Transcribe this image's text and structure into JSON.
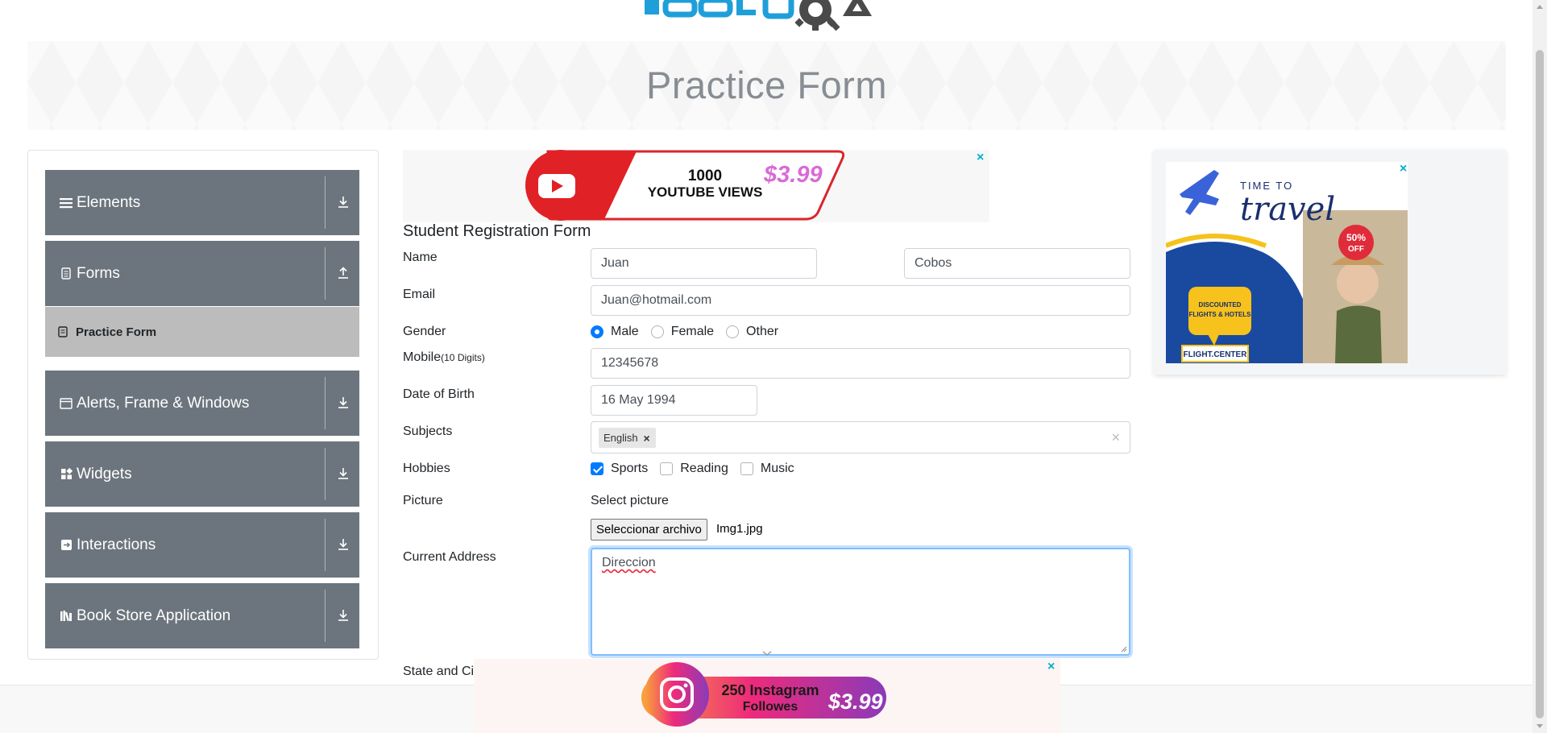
{
  "header": {
    "logo_text": "TOOLSQA",
    "page_title": "Practice Form"
  },
  "sidebar": {
    "groups": [
      {
        "label": "Elements",
        "icon": "hamburger-icon",
        "arrow": "download-icon"
      },
      {
        "label": "Forms",
        "icon": "document-icon",
        "arrow": "upload-icon"
      },
      {
        "label": "Alerts, Frame & Windows",
        "icon": "window-icon",
        "arrow": "download-icon"
      },
      {
        "label": "Widgets",
        "icon": "widgets-icon",
        "arrow": "download-icon"
      },
      {
        "label": "Interactions",
        "icon": "interactions-icon",
        "arrow": "download-icon"
      },
      {
        "label": "Book Store Application",
        "icon": "books-icon",
        "arrow": "download-icon"
      }
    ],
    "active_item": {
      "label": "Practice Form",
      "icon": "document-icon"
    }
  },
  "ads": {
    "top": {
      "line1": "1000",
      "line2": "YOUTUBE VIEWS",
      "price": "$3.99",
      "close": "×"
    },
    "right": {
      "title_small": "TIME TO",
      "title_big": "travel",
      "discount": "50%",
      "discount_sub": "OFF",
      "bubble": "DISCOUNTED FLIGHTS & HOTELS",
      "brand": "FLIGHT.CENTER",
      "close": "×"
    },
    "bottom": {
      "line1": "250 Instagram",
      "line2": "Followes",
      "price": "$3.99",
      "close": "×"
    }
  },
  "form": {
    "title": "Student Registration Form",
    "labels": {
      "name": "Name",
      "email": "Email",
      "gender": "Gender",
      "mobile": "Mobile",
      "mobile_hint": "(10 Digits)",
      "dob": "Date of Birth",
      "subjects": "Subjects",
      "hobbies": "Hobbies",
      "picture": "Picture",
      "address": "Current Address",
      "state_city": "State and Cit"
    },
    "first_name": "Juan",
    "last_name": "Cobos",
    "email": "Juan@hotmail.com",
    "gender_options": [
      {
        "label": "Male",
        "checked": true
      },
      {
        "label": "Female",
        "checked": false
      },
      {
        "label": "Other",
        "checked": false
      }
    ],
    "mobile": "12345678",
    "dob": "16 May 1994",
    "subjects": [
      {
        "label": "English",
        "remove": "×"
      }
    ],
    "subjects_clear": "×",
    "hobbies": [
      {
        "label": "Sports",
        "checked": true
      },
      {
        "label": "Reading",
        "checked": false
      },
      {
        "label": "Music",
        "checked": false
      }
    ],
    "picture_prompt": "Select picture",
    "file_button": "Seleccionar archivo",
    "file_name": "Img1.jpg",
    "address": "Direccion"
  },
  "colors": {
    "sidebar_header": "#6c757d",
    "active_item": "#bcbcbc",
    "primary": "#007bff",
    "logo_blue": "#1f9fd9",
    "ad_close": "#00aecd"
  }
}
